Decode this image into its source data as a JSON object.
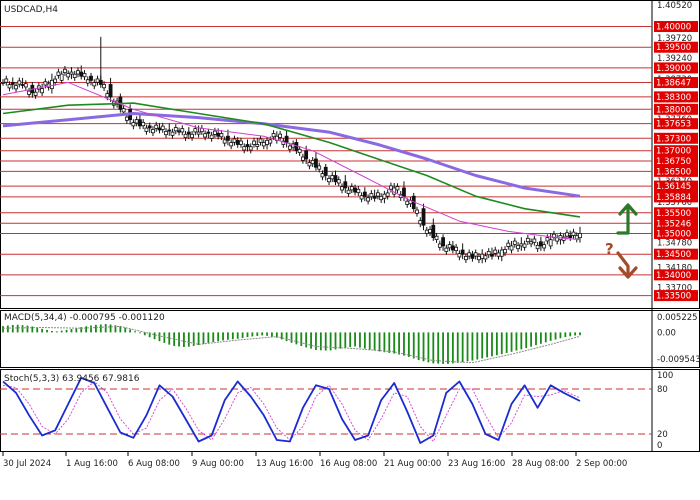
{
  "chart_data": [
    {
      "type": "candlestick",
      "symbol": "USDCAD,H4",
      "y_top_label": "1.40520",
      "ylim": [
        1.332,
        1.4052
      ],
      "price_ticks": [
        "1.39720",
        "1.39240",
        "1.38730",
        "1.38240",
        "1.37760",
        "1.37250",
        "1.36760",
        "1.36270",
        "1.35760",
        "1.35280",
        "1.34780",
        "1.34180",
        "1.33700"
      ],
      "levels": [
        {
          "value": 1.4,
          "label": "1.40000"
        },
        {
          "value": 1.395,
          "label": "1.39500"
        },
        {
          "value": 1.39,
          "label": "1.39000"
        },
        {
          "value": 1.38647,
          "label": "1.38647"
        },
        {
          "value": 1.383,
          "label": "1.38300"
        },
        {
          "value": 1.38,
          "label": "1.38000"
        },
        {
          "value": 1.37653,
          "label": "1.37653"
        },
        {
          "value": 1.373,
          "label": "1.37300"
        },
        {
          "value": 1.37,
          "label": "1.37000"
        },
        {
          "value": 1.3675,
          "label": "1.36750"
        },
        {
          "value": 1.365,
          "label": "1.36500"
        },
        {
          "value": 1.36145,
          "label": "1.36145"
        },
        {
          "value": 1.35884,
          "label": "1.35884"
        },
        {
          "value": 1.355,
          "label": "1.35500"
        },
        {
          "value": 1.35246,
          "label": "1.35246"
        },
        {
          "value": 1.35,
          "label": "1.35000"
        },
        {
          "value": 1.345,
          "label": "1.34500"
        },
        {
          "value": 1.34,
          "label": "1.34000"
        },
        {
          "value": 1.335,
          "label": "1.33500"
        }
      ],
      "x_labels": [
        "30 Jul 2024",
        "1 Aug 16:00",
        "6 Aug 08:00",
        "9 Aug 00:00",
        "13 Aug 16:00",
        "16 Aug 08:00",
        "21 Aug 00:00",
        "23 Aug 16:00",
        "28 Aug 08:00",
        "2 Sep 00:00"
      ],
      "close_path": [
        [
          0,
          1.3865
        ],
        [
          3,
          1.386
        ],
        [
          6,
          1.3858
        ],
        [
          9,
          1.384
        ],
        [
          12,
          1.385
        ],
        [
          15,
          1.387
        ],
        [
          18,
          1.3885
        ],
        [
          21,
          1.389
        ],
        [
          24,
          1.388
        ],
        [
          27,
          1.387
        ],
        [
          30,
          1.386
        ],
        [
          33,
          1.383
        ],
        [
          36,
          1.38
        ],
        [
          39,
          1.3775
        ],
        [
          42,
          1.376
        ],
        [
          45,
          1.3755
        ],
        [
          48,
          1.375
        ],
        [
          51,
          1.3748
        ],
        [
          54,
          1.3745
        ],
        [
          57,
          1.374
        ],
        [
          60,
          1.3745
        ],
        [
          63,
          1.3742
        ],
        [
          66,
          1.3735
        ],
        [
          69,
          1.3725
        ],
        [
          72,
          1.3715
        ],
        [
          75,
          1.371
        ],
        [
          78,
          1.3715
        ],
        [
          81,
          1.3725
        ],
        [
          84,
          1.3735
        ],
        [
          87,
          1.372
        ],
        [
          90,
          1.37
        ],
        [
          93,
          1.368
        ],
        [
          96,
          1.366
        ],
        [
          99,
          1.364
        ],
        [
          102,
          1.3625
        ],
        [
          105,
          1.361
        ],
        [
          108,
          1.36
        ],
        [
          111,
          1.359
        ],
        [
          114,
          1.3585
        ],
        [
          117,
          1.3595
        ],
        [
          120,
          1.361
        ],
        [
          123,
          1.359
        ],
        [
          126,
          1.356
        ],
        [
          129,
          1.352
        ],
        [
          132,
          1.349
        ],
        [
          135,
          1.347
        ],
        [
          138,
          1.346
        ],
        [
          141,
          1.345
        ],
        [
          144,
          1.344
        ],
        [
          147,
          1.345
        ],
        [
          150,
          1.3445
        ],
        [
          153,
          1.346
        ],
        [
          156,
          1.347
        ],
        [
          159,
          1.3475
        ],
        [
          162,
          1.348
        ],
        [
          165,
          1.347
        ],
        [
          168,
          1.3485
        ],
        [
          171,
          1.3495
        ],
        [
          174,
          1.349
        ],
        [
          177,
          1.35
        ]
      ],
      "ma_fast": [
        [
          0,
          1.3835
        ],
        [
          20,
          1.3865
        ],
        [
          40,
          1.38
        ],
        [
          60,
          1.3755
        ],
        [
          80,
          1.3735
        ],
        [
          95,
          1.37
        ],
        [
          110,
          1.364
        ],
        [
          125,
          1.358
        ],
        [
          140,
          1.353
        ],
        [
          155,
          1.3505
        ],
        [
          170,
          1.349
        ],
        [
          177,
          1.3485
        ]
      ],
      "ma_mid": [
        [
          0,
          1.379
        ],
        [
          20,
          1.381
        ],
        [
          40,
          1.3815
        ],
        [
          60,
          1.379
        ],
        [
          80,
          1.3765
        ],
        [
          100,
          1.372
        ],
        [
          115,
          1.368
        ],
        [
          130,
          1.364
        ],
        [
          145,
          1.359
        ],
        [
          160,
          1.356
        ],
        [
          177,
          1.354
        ]
      ],
      "ma_slow": [
        [
          0,
          1.376
        ],
        [
          20,
          1.3775
        ],
        [
          40,
          1.379
        ],
        [
          60,
          1.378
        ],
        [
          80,
          1.3765
        ],
        [
          100,
          1.3745
        ],
        [
          115,
          1.3715
        ],
        [
          130,
          1.368
        ],
        [
          145,
          1.364
        ],
        [
          160,
          1.361
        ],
        [
          177,
          1.359
        ]
      ],
      "annotations": {
        "question": "?",
        "up_arrow_color": "#2a7a2a",
        "down_arrow_color": "#a54a2a"
      },
      "colors": {
        "level_label_bg": "#e00000",
        "level_line": "#c83232",
        "ma_fast": "#d040d0",
        "ma_mid": "#1f8a1f",
        "ma_slow": "#8a6ae0",
        "candle": "#111111"
      }
    },
    {
      "type": "bar",
      "name": "MACD(5,34,4) -0.000795 -0.001120",
      "y_labels": [
        "0.005225",
        "0.00",
        "-0.009543"
      ],
      "ylim": [
        -0.009543,
        0.005225
      ],
      "hist": [
        [
          0,
          0.0018
        ],
        [
          4,
          0.0022
        ],
        [
          8,
          0.0019
        ],
        [
          12,
          0.001
        ],
        [
          16,
          0.0002
        ],
        [
          20,
          0.0008
        ],
        [
          24,
          0.0015
        ],
        [
          28,
          0.0021
        ],
        [
          32,
          0.0024
        ],
        [
          36,
          0.0018
        ],
        [
          40,
          0.0005
        ],
        [
          44,
          -0.001
        ],
        [
          48,
          -0.0025
        ],
        [
          52,
          -0.0038
        ],
        [
          56,
          -0.0042
        ],
        [
          60,
          -0.0036
        ],
        [
          64,
          -0.0028
        ],
        [
          68,
          -0.0022
        ],
        [
          72,
          -0.0018
        ],
        [
          76,
          -0.0012
        ],
        [
          80,
          -0.0008
        ],
        [
          84,
          -0.0015
        ],
        [
          88,
          -0.0028
        ],
        [
          92,
          -0.004
        ],
        [
          96,
          -0.005
        ],
        [
          100,
          -0.0052
        ],
        [
          104,
          -0.0045
        ],
        [
          108,
          -0.004
        ],
        [
          112,
          -0.0048
        ],
        [
          116,
          -0.0055
        ],
        [
          120,
          -0.006
        ],
        [
          124,
          -0.0068
        ],
        [
          128,
          -0.008
        ],
        [
          132,
          -0.0088
        ],
        [
          136,
          -0.009
        ],
        [
          140,
          -0.0086
        ],
        [
          144,
          -0.008
        ],
        [
          148,
          -0.0072
        ],
        [
          152,
          -0.0064
        ],
        [
          156,
          -0.0055
        ],
        [
          160,
          -0.0046
        ],
        [
          164,
          -0.0035
        ],
        [
          168,
          -0.0024
        ],
        [
          172,
          -0.0014
        ],
        [
          176,
          -0.0008
        ]
      ],
      "signal": [
        [
          0,
          0.0012
        ],
        [
          12,
          0.0014
        ],
        [
          24,
          0.0012
        ],
        [
          36,
          0.0017
        ],
        [
          48,
          -0.001
        ],
        [
          60,
          -0.0034
        ],
        [
          72,
          -0.0022
        ],
        [
          84,
          -0.0012
        ],
        [
          96,
          -0.004
        ],
        [
          108,
          -0.0046
        ],
        [
          120,
          -0.0055
        ],
        [
          132,
          -0.008
        ],
        [
          144,
          -0.0086
        ],
        [
          156,
          -0.0062
        ],
        [
          168,
          -0.0034
        ],
        [
          177,
          -0.0011
        ]
      ],
      "colors": {
        "bar": "#178a17",
        "signal": "#8a8a8a"
      }
    },
    {
      "type": "line",
      "name": "Stoch(5,3,3) 63.9456 67.9816",
      "y_labels": [
        "100",
        "80",
        "20",
        "0"
      ],
      "ylim": [
        0,
        100
      ],
      "k": [
        [
          0,
          90
        ],
        [
          4,
          75
        ],
        [
          8,
          45
        ],
        [
          12,
          18
        ],
        [
          16,
          25
        ],
        [
          20,
          60
        ],
        [
          24,
          95
        ],
        [
          28,
          88
        ],
        [
          32,
          55
        ],
        [
          36,
          22
        ],
        [
          40,
          15
        ],
        [
          44,
          45
        ],
        [
          48,
          85
        ],
        [
          52,
          70
        ],
        [
          56,
          40
        ],
        [
          60,
          10
        ],
        [
          64,
          18
        ],
        [
          68,
          65
        ],
        [
          72,
          90
        ],
        [
          76,
          70
        ],
        [
          80,
          45
        ],
        [
          84,
          12
        ],
        [
          88,
          10
        ],
        [
          92,
          55
        ],
        [
          96,
          85
        ],
        [
          100,
          80
        ],
        [
          104,
          40
        ],
        [
          108,
          12
        ],
        [
          112,
          18
        ],
        [
          116,
          65
        ],
        [
          120,
          88
        ],
        [
          124,
          50
        ],
        [
          128,
          8
        ],
        [
          132,
          18
        ],
        [
          136,
          75
        ],
        [
          140,
          90
        ],
        [
          144,
          60
        ],
        [
          148,
          20
        ],
        [
          152,
          12
        ],
        [
          156,
          60
        ],
        [
          160,
          85
        ],
        [
          164,
          55
        ],
        [
          168,
          85
        ],
        [
          172,
          75
        ],
        [
          177,
          64
        ]
      ],
      "d": [
        [
          0,
          85
        ],
        [
          4,
          82
        ],
        [
          8,
          60
        ],
        [
          12,
          30
        ],
        [
          16,
          20
        ],
        [
          20,
          40
        ],
        [
          24,
          75
        ],
        [
          28,
          90
        ],
        [
          32,
          75
        ],
        [
          36,
          40
        ],
        [
          40,
          20
        ],
        [
          44,
          28
        ],
        [
          48,
          65
        ],
        [
          52,
          80
        ],
        [
          56,
          55
        ],
        [
          60,
          25
        ],
        [
          64,
          12
        ],
        [
          68,
          40
        ],
        [
          72,
          75
        ],
        [
          76,
          82
        ],
        [
          80,
          60
        ],
        [
          84,
          28
        ],
        [
          88,
          12
        ],
        [
          92,
          30
        ],
        [
          96,
          70
        ],
        [
          100,
          85
        ],
        [
          104,
          60
        ],
        [
          108,
          25
        ],
        [
          112,
          12
        ],
        [
          116,
          40
        ],
        [
          120,
          75
        ],
        [
          124,
          70
        ],
        [
          128,
          30
        ],
        [
          132,
          10
        ],
        [
          136,
          45
        ],
        [
          140,
          80
        ],
        [
          144,
          80
        ],
        [
          148,
          45
        ],
        [
          152,
          15
        ],
        [
          156,
          35
        ],
        [
          160,
          72
        ],
        [
          164,
          70
        ],
        [
          168,
          72
        ],
        [
          172,
          78
        ],
        [
          177,
          68
        ]
      ],
      "levels": [
        80,
        20
      ],
      "colors": {
        "k": "#1a2bd0",
        "d": "#d040d0",
        "level": "#c83232"
      }
    }
  ]
}
